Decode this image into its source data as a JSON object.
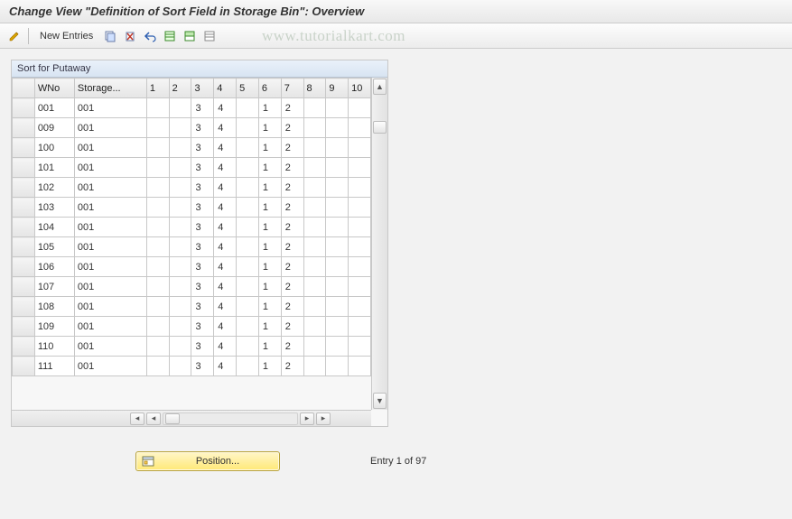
{
  "header": {
    "title": "Change View \"Definition of Sort Field in Storage Bin\": Overview"
  },
  "toolbar": {
    "new_entries": "New Entries"
  },
  "watermark": "www.tutorialkart.com",
  "panel": {
    "title": "Sort for Putaway"
  },
  "columns": {
    "wno": "WNo",
    "storage": "Storage...",
    "c1": "1",
    "c2": "2",
    "c3": "3",
    "c4": "4",
    "c5": "5",
    "c6": "6",
    "c7": "7",
    "c8": "8",
    "c9": "9",
    "c10": "10"
  },
  "rows": [
    {
      "wno": "001",
      "stor": "001",
      "v": [
        "",
        "",
        "3",
        "4",
        "",
        "1",
        "2",
        "",
        "",
        ""
      ]
    },
    {
      "wno": "009",
      "stor": "001",
      "v": [
        "",
        "",
        "3",
        "4",
        "",
        "1",
        "2",
        "",
        "",
        ""
      ]
    },
    {
      "wno": "100",
      "stor": "001",
      "v": [
        "",
        "",
        "3",
        "4",
        "",
        "1",
        "2",
        "",
        "",
        ""
      ]
    },
    {
      "wno": "101",
      "stor": "001",
      "v": [
        "",
        "",
        "3",
        "4",
        "",
        "1",
        "2",
        "",
        "",
        ""
      ]
    },
    {
      "wno": "102",
      "stor": "001",
      "v": [
        "",
        "",
        "3",
        "4",
        "",
        "1",
        "2",
        "",
        "",
        ""
      ]
    },
    {
      "wno": "103",
      "stor": "001",
      "v": [
        "",
        "",
        "3",
        "4",
        "",
        "1",
        "2",
        "",
        "",
        ""
      ]
    },
    {
      "wno": "104",
      "stor": "001",
      "v": [
        "",
        "",
        "3",
        "4",
        "",
        "1",
        "2",
        "",
        "",
        ""
      ]
    },
    {
      "wno": "105",
      "stor": "001",
      "v": [
        "",
        "",
        "3",
        "4",
        "",
        "1",
        "2",
        "",
        "",
        ""
      ]
    },
    {
      "wno": "106",
      "stor": "001",
      "v": [
        "",
        "",
        "3",
        "4",
        "",
        "1",
        "2",
        "",
        "",
        ""
      ]
    },
    {
      "wno": "107",
      "stor": "001",
      "v": [
        "",
        "",
        "3",
        "4",
        "",
        "1",
        "2",
        "",
        "",
        ""
      ]
    },
    {
      "wno": "108",
      "stor": "001",
      "v": [
        "",
        "",
        "3",
        "4",
        "",
        "1",
        "2",
        "",
        "",
        ""
      ]
    },
    {
      "wno": "109",
      "stor": "001",
      "v": [
        "",
        "",
        "3",
        "4",
        "",
        "1",
        "2",
        "",
        "",
        ""
      ]
    },
    {
      "wno": "110",
      "stor": "001",
      "v": [
        "",
        "",
        "3",
        "4",
        "",
        "1",
        "2",
        "",
        "",
        ""
      ]
    },
    {
      "wno": "111",
      "stor": "001",
      "v": [
        "",
        "",
        "3",
        "4",
        "",
        "1",
        "2",
        "",
        "",
        ""
      ]
    }
  ],
  "footer": {
    "position_label": "Position...",
    "entry_text": "Entry 1 of 97"
  }
}
